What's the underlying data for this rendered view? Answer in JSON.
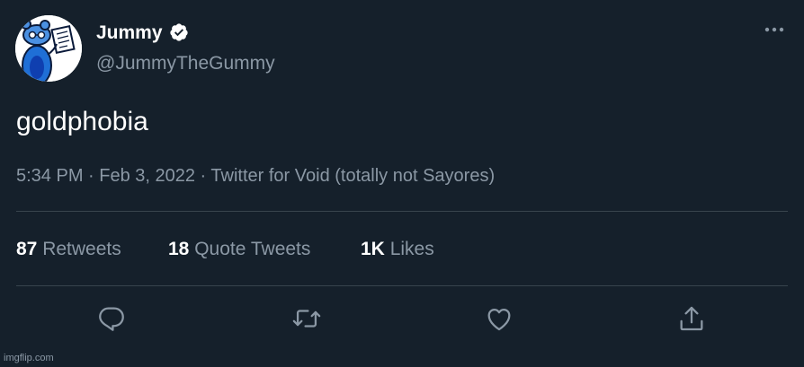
{
  "author": {
    "display_name": "Jummy",
    "handle": "@JummyTheGummy",
    "verified": true,
    "avatar_icon": "blue-creature-avatar-icon"
  },
  "tweet": {
    "text": "goldphobia",
    "meta": "5:34 PM · Feb 3, 2022 · Twitter for Void (totally not Sayores)"
  },
  "stats": {
    "retweets_count": "87",
    "retweets_label": "Retweets",
    "quotes_count": "18",
    "quotes_label": "Quote Tweets",
    "likes_count": "1K",
    "likes_label": "Likes"
  },
  "actions": [
    "reply-icon",
    "retweet-icon",
    "like-icon",
    "share-icon"
  ],
  "watermark": "imgflip.com",
  "colors": {
    "background": "#15202b",
    "text_primary": "#ffffff",
    "text_secondary": "#8b98a5",
    "divider": "#38444d",
    "verified_badge": "#ffffff"
  }
}
